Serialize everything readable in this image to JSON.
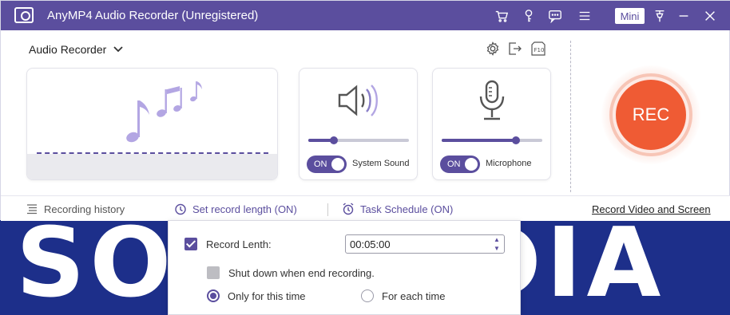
{
  "watermark": "SOFTPEDIA",
  "window": {
    "title": "AnyMP4 Audio Recorder (Unregistered)",
    "mini_label": "Mini"
  },
  "titlebar_icons": [
    "cart-icon",
    "key-icon",
    "chat-icon",
    "menu-icon",
    "pin-icon",
    "minimize-icon",
    "close-icon"
  ],
  "mode_selector": {
    "label": "Audio Recorder"
  },
  "system_sound": {
    "toggle": "ON",
    "label": "System Sound",
    "volume": 0.25
  },
  "microphone": {
    "toggle": "ON",
    "label": "Microphone",
    "volume": 0.74
  },
  "rec_button": {
    "label": "REC"
  },
  "bottom_bar": {
    "history": "Recording history",
    "record_length": "Set record length (ON)",
    "task_schedule": "Task Schedule (ON)",
    "video_link": "Record Video and Screen"
  },
  "record_length_panel": {
    "record_label": "Record Lenth:",
    "record_checked": true,
    "time_value": "00:05:00",
    "shutdown_label": "Shut down when end recording.",
    "shutdown_checked": false,
    "option_once": "Only for this time",
    "option_each": "For each time",
    "selected_option": "Only for this time"
  },
  "colors": {
    "accent": "#5b4e9e",
    "rec": "#ef5b34"
  }
}
